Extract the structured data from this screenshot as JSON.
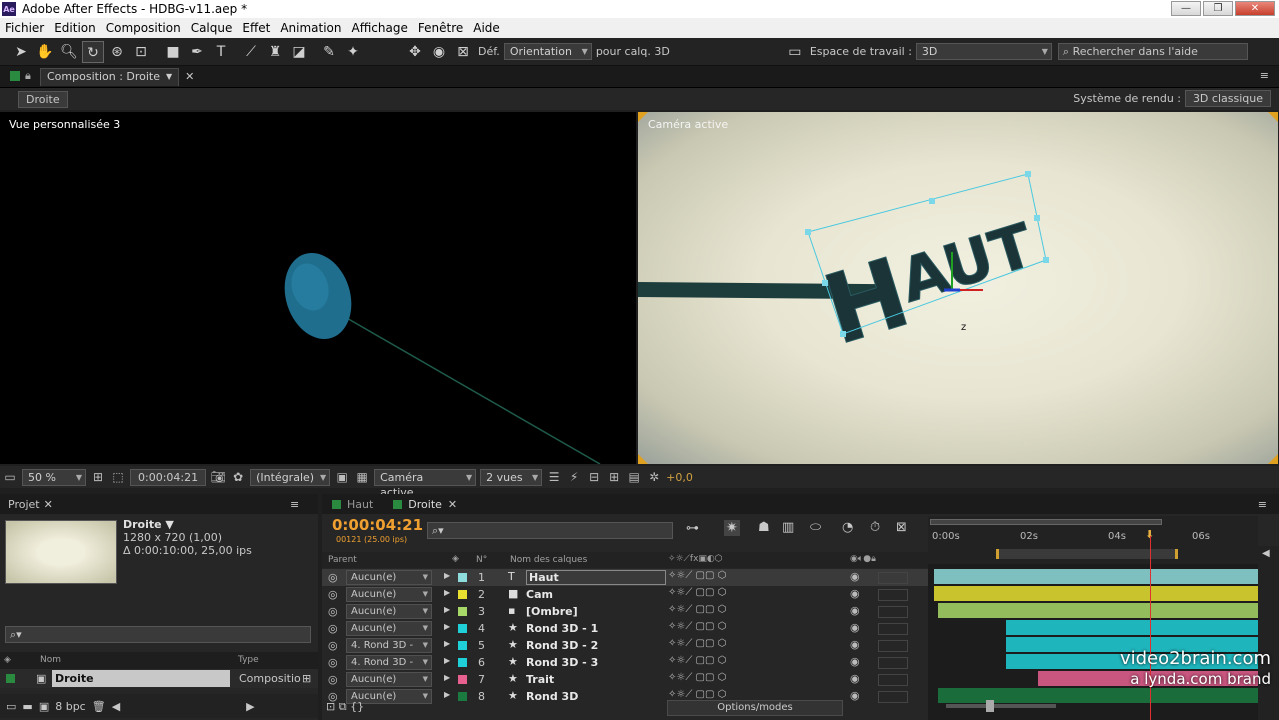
{
  "window": {
    "title": "Adobe After Effects - HDBG-v11.aep *",
    "app_icon": "Ae"
  },
  "menu": [
    "Fichier",
    "Edition",
    "Composition",
    "Calque",
    "Effet",
    "Animation",
    "Affichage",
    "Fenêtre",
    "Aide"
  ],
  "toolbar": {
    "def_label": "Déf.",
    "orientation": "Orientation",
    "for_3d_label": "pour calq. 3D",
    "workspace_label": "Espace de travail :",
    "workspace_value": "3D",
    "search_placeholder": "Rechercher dans l'aide"
  },
  "composition": {
    "tab_label": "Composition : Droite",
    "comp_chip": "Droite",
    "renderer_label": "Système de rendu :",
    "renderer_value": "3D classique",
    "left_view_label": "Vue personnalisée 3",
    "right_view_label": "Caméra active",
    "haut_text": "HAUT",
    "axis_label": "z"
  },
  "viewer_bar": {
    "zoom": "50 %",
    "timecode": "0:00:04:21",
    "resolution": "(Intégrale)",
    "camera": "Caméra active",
    "views": "2 vues",
    "exposure": "+0,0"
  },
  "project": {
    "tab_label": "Projet",
    "comp_name": "Droite ▼",
    "dims": "1280 x 720 (1,00)",
    "duration": "Δ 0:00:10:00, 25,00 ips",
    "col_name": "Nom",
    "col_type": "Type",
    "row_name": "Droite",
    "row_type": "Compositio",
    "bpc": "8 bpc"
  },
  "timeline": {
    "tabs": [
      "Haut",
      "Droite"
    ],
    "timecode": "0:00:04:21",
    "frames": "00121 (25.00 ips)",
    "col_parent": "Parent",
    "col_num": "N°",
    "col_name": "Nom des calques",
    "ruler": [
      "0:00s",
      "02s",
      "04s",
      "06s"
    ],
    "options_label": "Options/modes",
    "layers": [
      {
        "num": "1",
        "parent": "Aucun(e)",
        "name": "Haut",
        "color": "#8fdcdc",
        "type": "T"
      },
      {
        "num": "2",
        "parent": "Aucun(e)",
        "name": "Cam",
        "color": "#e8e030",
        "type": "■"
      },
      {
        "num": "3",
        "parent": "Aucun(e)",
        "name": "[Ombre]",
        "color": "#a8d868",
        "type": "▪"
      },
      {
        "num": "4",
        "parent": "Aucun(e)",
        "name": "Rond 3D - 1",
        "color": "#20d0d8",
        "type": "★"
      },
      {
        "num": "5",
        "parent": "4. Rond 3D -",
        "name": "Rond 3D - 2",
        "color": "#20d0d8",
        "type": "★"
      },
      {
        "num": "6",
        "parent": "4. Rond 3D -",
        "name": "Rond 3D - 3",
        "color": "#20d0d8",
        "type": "★"
      },
      {
        "num": "7",
        "parent": "Aucun(e)",
        "name": "Trait",
        "color": "#e86090",
        "type": "★"
      },
      {
        "num": "8",
        "parent": "Aucun(e)",
        "name": "Rond 3D",
        "color": "#1a7a40",
        "type": "★"
      }
    ]
  },
  "watermark": {
    "line1": "video2brain.com",
    "line2": "a lynda.com brand"
  }
}
